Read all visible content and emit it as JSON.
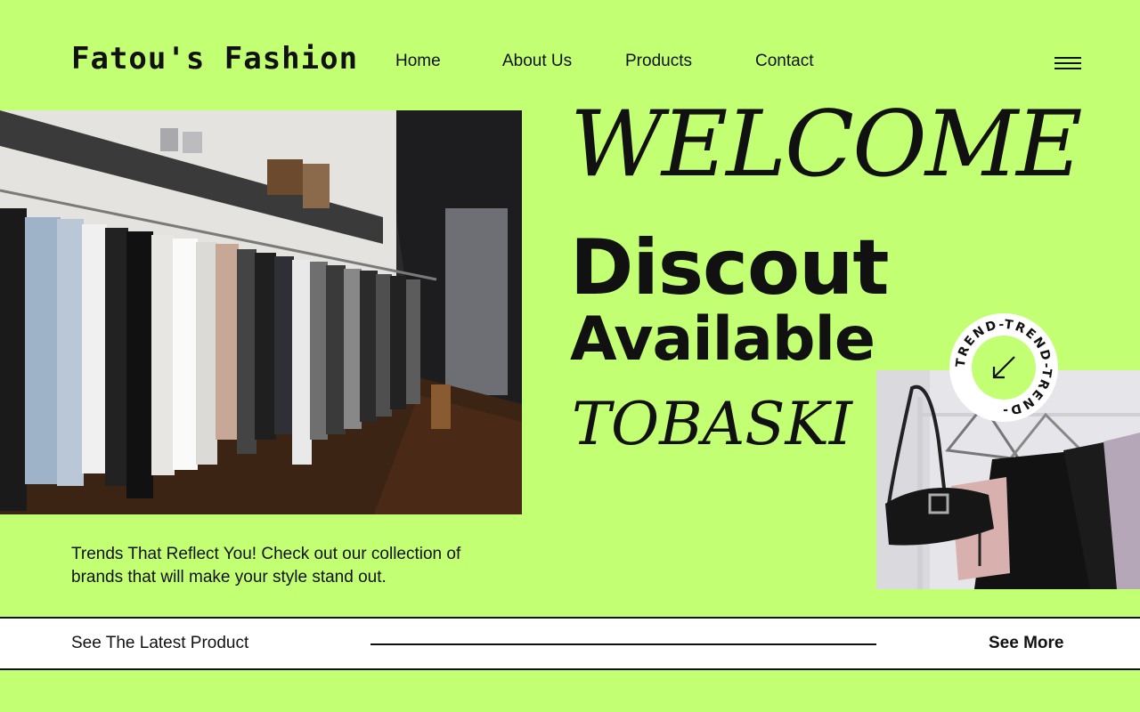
{
  "brand": {
    "name": "Fatou's Fashion"
  },
  "nav": {
    "items": [
      {
        "label": "Home"
      },
      {
        "label": "About Us"
      },
      {
        "label": "Products"
      },
      {
        "label": "Contact"
      }
    ]
  },
  "hero": {
    "welcome": "WELCOME",
    "line1": "Discout",
    "line2": "Available",
    "line3": "TOBASKI"
  },
  "badge": {
    "text": "TREND-TREND-TREND-",
    "icon": "arrow-down-left-icon"
  },
  "tagline": "Trends That Reflect You! Check out our collection of brands that will make your style stand out.",
  "bottom_bar": {
    "left_label": "See The Latest Product",
    "cta_label": "See More"
  },
  "colors": {
    "background": "#c3ff73",
    "text": "#111111",
    "bar": "#ffffff"
  }
}
